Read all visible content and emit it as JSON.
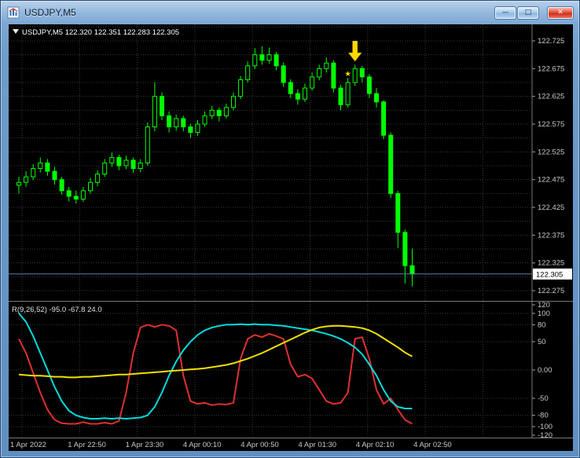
{
  "window": {
    "title": "USDJPY,M5",
    "controls": {
      "minimize": "—",
      "maximize": "□",
      "close": "✕"
    }
  },
  "chart_data": {
    "type": "candlestick",
    "symbol": "USDJPY",
    "timeframe": "M5",
    "ohlc_display": {
      "open": "122.320",
      "high": "122.351",
      "low": "122.283",
      "close": "122.305"
    },
    "current_price": 122.305,
    "price_axis": {
      "min": 122.275,
      "max": 122.725,
      "labels": [
        "122.725",
        "122.675",
        "122.625",
        "122.575",
        "122.525",
        "122.475",
        "122.425",
        "122.375",
        "122.325",
        "122.275"
      ]
    },
    "time_labels": [
      "1 Apr 2022",
      "1 Apr 22:50",
      "1 Apr 23:30",
      "4 Apr 00:10",
      "4 Apr 00:50",
      "4 Apr 01:30",
      "4 Apr 02:10",
      "4 Apr 02:50"
    ],
    "bars": [
      [
        122.465,
        122.48,
        122.45,
        122.47
      ],
      [
        122.47,
        122.49,
        122.462,
        122.48
      ],
      [
        122.48,
        122.503,
        122.474,
        122.495
      ],
      [
        122.495,
        122.515,
        122.488,
        122.505
      ],
      [
        122.505,
        122.512,
        122.482,
        122.49
      ],
      [
        122.49,
        122.498,
        122.466,
        122.475
      ],
      [
        122.475,
        122.48,
        122.448,
        122.455
      ],
      [
        122.455,
        122.462,
        122.436,
        122.445
      ],
      [
        122.445,
        122.455,
        122.432,
        122.44
      ],
      [
        122.44,
        122.462,
        122.435,
        122.455
      ],
      [
        122.455,
        122.478,
        122.45,
        122.47
      ],
      [
        122.47,
        122.492,
        122.463,
        122.485
      ],
      [
        122.485,
        122.512,
        122.48,
        122.505
      ],
      [
        122.505,
        122.524,
        122.498,
        122.515
      ],
      [
        122.515,
        122.52,
        122.492,
        122.5
      ],
      [
        122.5,
        122.518,
        122.494,
        122.51
      ],
      [
        122.51,
        122.515,
        122.487,
        122.495
      ],
      [
        122.495,
        122.512,
        122.488,
        122.505
      ],
      [
        122.505,
        122.578,
        122.5,
        122.57
      ],
      [
        122.57,
        122.65,
        122.562,
        122.625
      ],
      [
        122.625,
        122.632,
        122.582,
        122.59
      ],
      [
        122.59,
        122.598,
        122.56,
        122.57
      ],
      [
        122.57,
        122.592,
        122.563,
        122.585
      ],
      [
        122.585,
        122.59,
        122.562,
        122.57
      ],
      [
        122.57,
        122.576,
        122.55,
        122.56
      ],
      [
        122.56,
        122.582,
        122.554,
        122.575
      ],
      [
        122.575,
        122.598,
        122.57,
        122.59
      ],
      [
        122.59,
        122.608,
        122.584,
        122.6
      ],
      [
        122.6,
        122.605,
        122.58,
        122.59
      ],
      [
        122.59,
        122.612,
        122.585,
        122.605
      ],
      [
        122.605,
        122.632,
        122.6,
        122.625
      ],
      [
        122.625,
        122.662,
        122.62,
        122.655
      ],
      [
        122.655,
        122.688,
        122.65,
        122.68
      ],
      [
        122.68,
        122.712,
        122.674,
        122.7
      ],
      [
        122.7,
        122.715,
        122.682,
        122.69
      ],
      [
        122.69,
        122.713,
        122.684,
        122.7
      ],
      [
        122.7,
        122.705,
        122.672,
        122.68
      ],
      [
        122.68,
        122.686,
        122.642,
        122.65
      ],
      [
        122.65,
        122.656,
        122.622,
        122.63
      ],
      [
        122.63,
        122.638,
        122.61,
        122.62
      ],
      [
        122.62,
        122.648,
        122.615,
        122.64
      ],
      [
        122.64,
        122.668,
        122.635,
        122.66
      ],
      [
        122.66,
        122.682,
        122.654,
        122.675
      ],
      [
        122.675,
        122.695,
        122.668,
        122.685
      ],
      [
        122.685,
        122.69,
        122.632,
        122.64
      ],
      [
        122.64,
        122.646,
        122.6,
        122.61
      ],
      [
        122.61,
        122.658,
        122.605,
        122.65
      ],
      [
        122.65,
        122.682,
        122.644,
        122.675
      ],
      [
        122.675,
        122.68,
        122.65,
        122.66
      ],
      [
        122.66,
        122.665,
        122.622,
        122.63
      ],
      [
        122.63,
        122.64,
        122.605,
        122.615
      ],
      [
        122.615,
        122.618,
        122.548,
        122.555
      ],
      [
        122.555,
        122.56,
        122.442,
        122.45
      ],
      [
        122.45,
        122.455,
        122.352,
        122.38
      ],
      [
        122.38,
        122.385,
        122.288,
        122.32
      ],
      [
        122.32,
        122.351,
        122.283,
        122.305
      ]
    ],
    "indicator": {
      "name": "R(9,26,52)",
      "values_display": "-95.0 -67.8 24.0",
      "range": [
        -120,
        120
      ],
      "axis_labels": [
        "120",
        "100",
        "80",
        "50",
        "0.00",
        "-50",
        "-80",
        "-100",
        "-120"
      ],
      "levels": [
        100,
        80,
        50,
        0,
        -50,
        -80,
        -100
      ],
      "series": [
        {
          "name": "fast",
          "color": "#e03030",
          "values": [
            55,
            30,
            -5,
            -40,
            -70,
            -88,
            -94,
            -95,
            -95,
            -92,
            -95,
            -95,
            -93,
            -95,
            -90,
            -40,
            30,
            75,
            80,
            76,
            80,
            78,
            70,
            -10,
            -55,
            -60,
            -58,
            -62,
            -60,
            -61,
            -58,
            20,
            55,
            62,
            58,
            64,
            60,
            55,
            10,
            -12,
            -8,
            -15,
            -35,
            -55,
            -60,
            -58,
            -40,
            55,
            58,
            20,
            -35,
            -60,
            -50,
            -70,
            -88,
            -95
          ]
        },
        {
          "name": "mid",
          "color": "#00dcdc",
          "values": [
            100,
            85,
            60,
            30,
            0,
            -30,
            -55,
            -72,
            -80,
            -84,
            -86,
            -86,
            -85,
            -86,
            -85,
            -86,
            -85,
            -84,
            -80,
            -65,
            -40,
            -10,
            15,
            35,
            50,
            62,
            70,
            75,
            78,
            80,
            80,
            81,
            80,
            81,
            80,
            80,
            79,
            78,
            76,
            74,
            72,
            70,
            67,
            64,
            60,
            55,
            48,
            40,
            28,
            10,
            -10,
            -35,
            -55,
            -65,
            -68,
            -68
          ]
        },
        {
          "name": "slow",
          "color": "#f0e000",
          "values": [
            -8,
            -9,
            -10,
            -10,
            -11,
            -12,
            -12,
            -13,
            -13,
            -12,
            -12,
            -11,
            -10,
            -9,
            -8,
            -8,
            -7,
            -6,
            -5,
            -4,
            -3,
            -2,
            -1,
            0,
            1,
            2,
            3,
            5,
            7,
            9,
            12,
            16,
            20,
            25,
            30,
            36,
            42,
            48,
            54,
            60,
            66,
            71,
            75,
            77,
            78,
            78,
            77,
            76,
            74,
            70,
            64,
            56,
            48,
            40,
            31,
            24
          ]
        }
      ]
    },
    "annotations": [
      {
        "type": "arrow-down",
        "bar": 47,
        "price": 122.688,
        "color": "#ffd800"
      },
      {
        "type": "star",
        "bar": 46,
        "price": 122.67,
        "color": "#ffd800"
      }
    ],
    "colors": {
      "background": "#000000",
      "grid": "#3a3a3a",
      "candle": "#00ff00",
      "axis_text": "#c8c8c8",
      "price_line": "#5b82ab",
      "price_tag_bg": "#ffffff",
      "separator": "#787878"
    }
  }
}
